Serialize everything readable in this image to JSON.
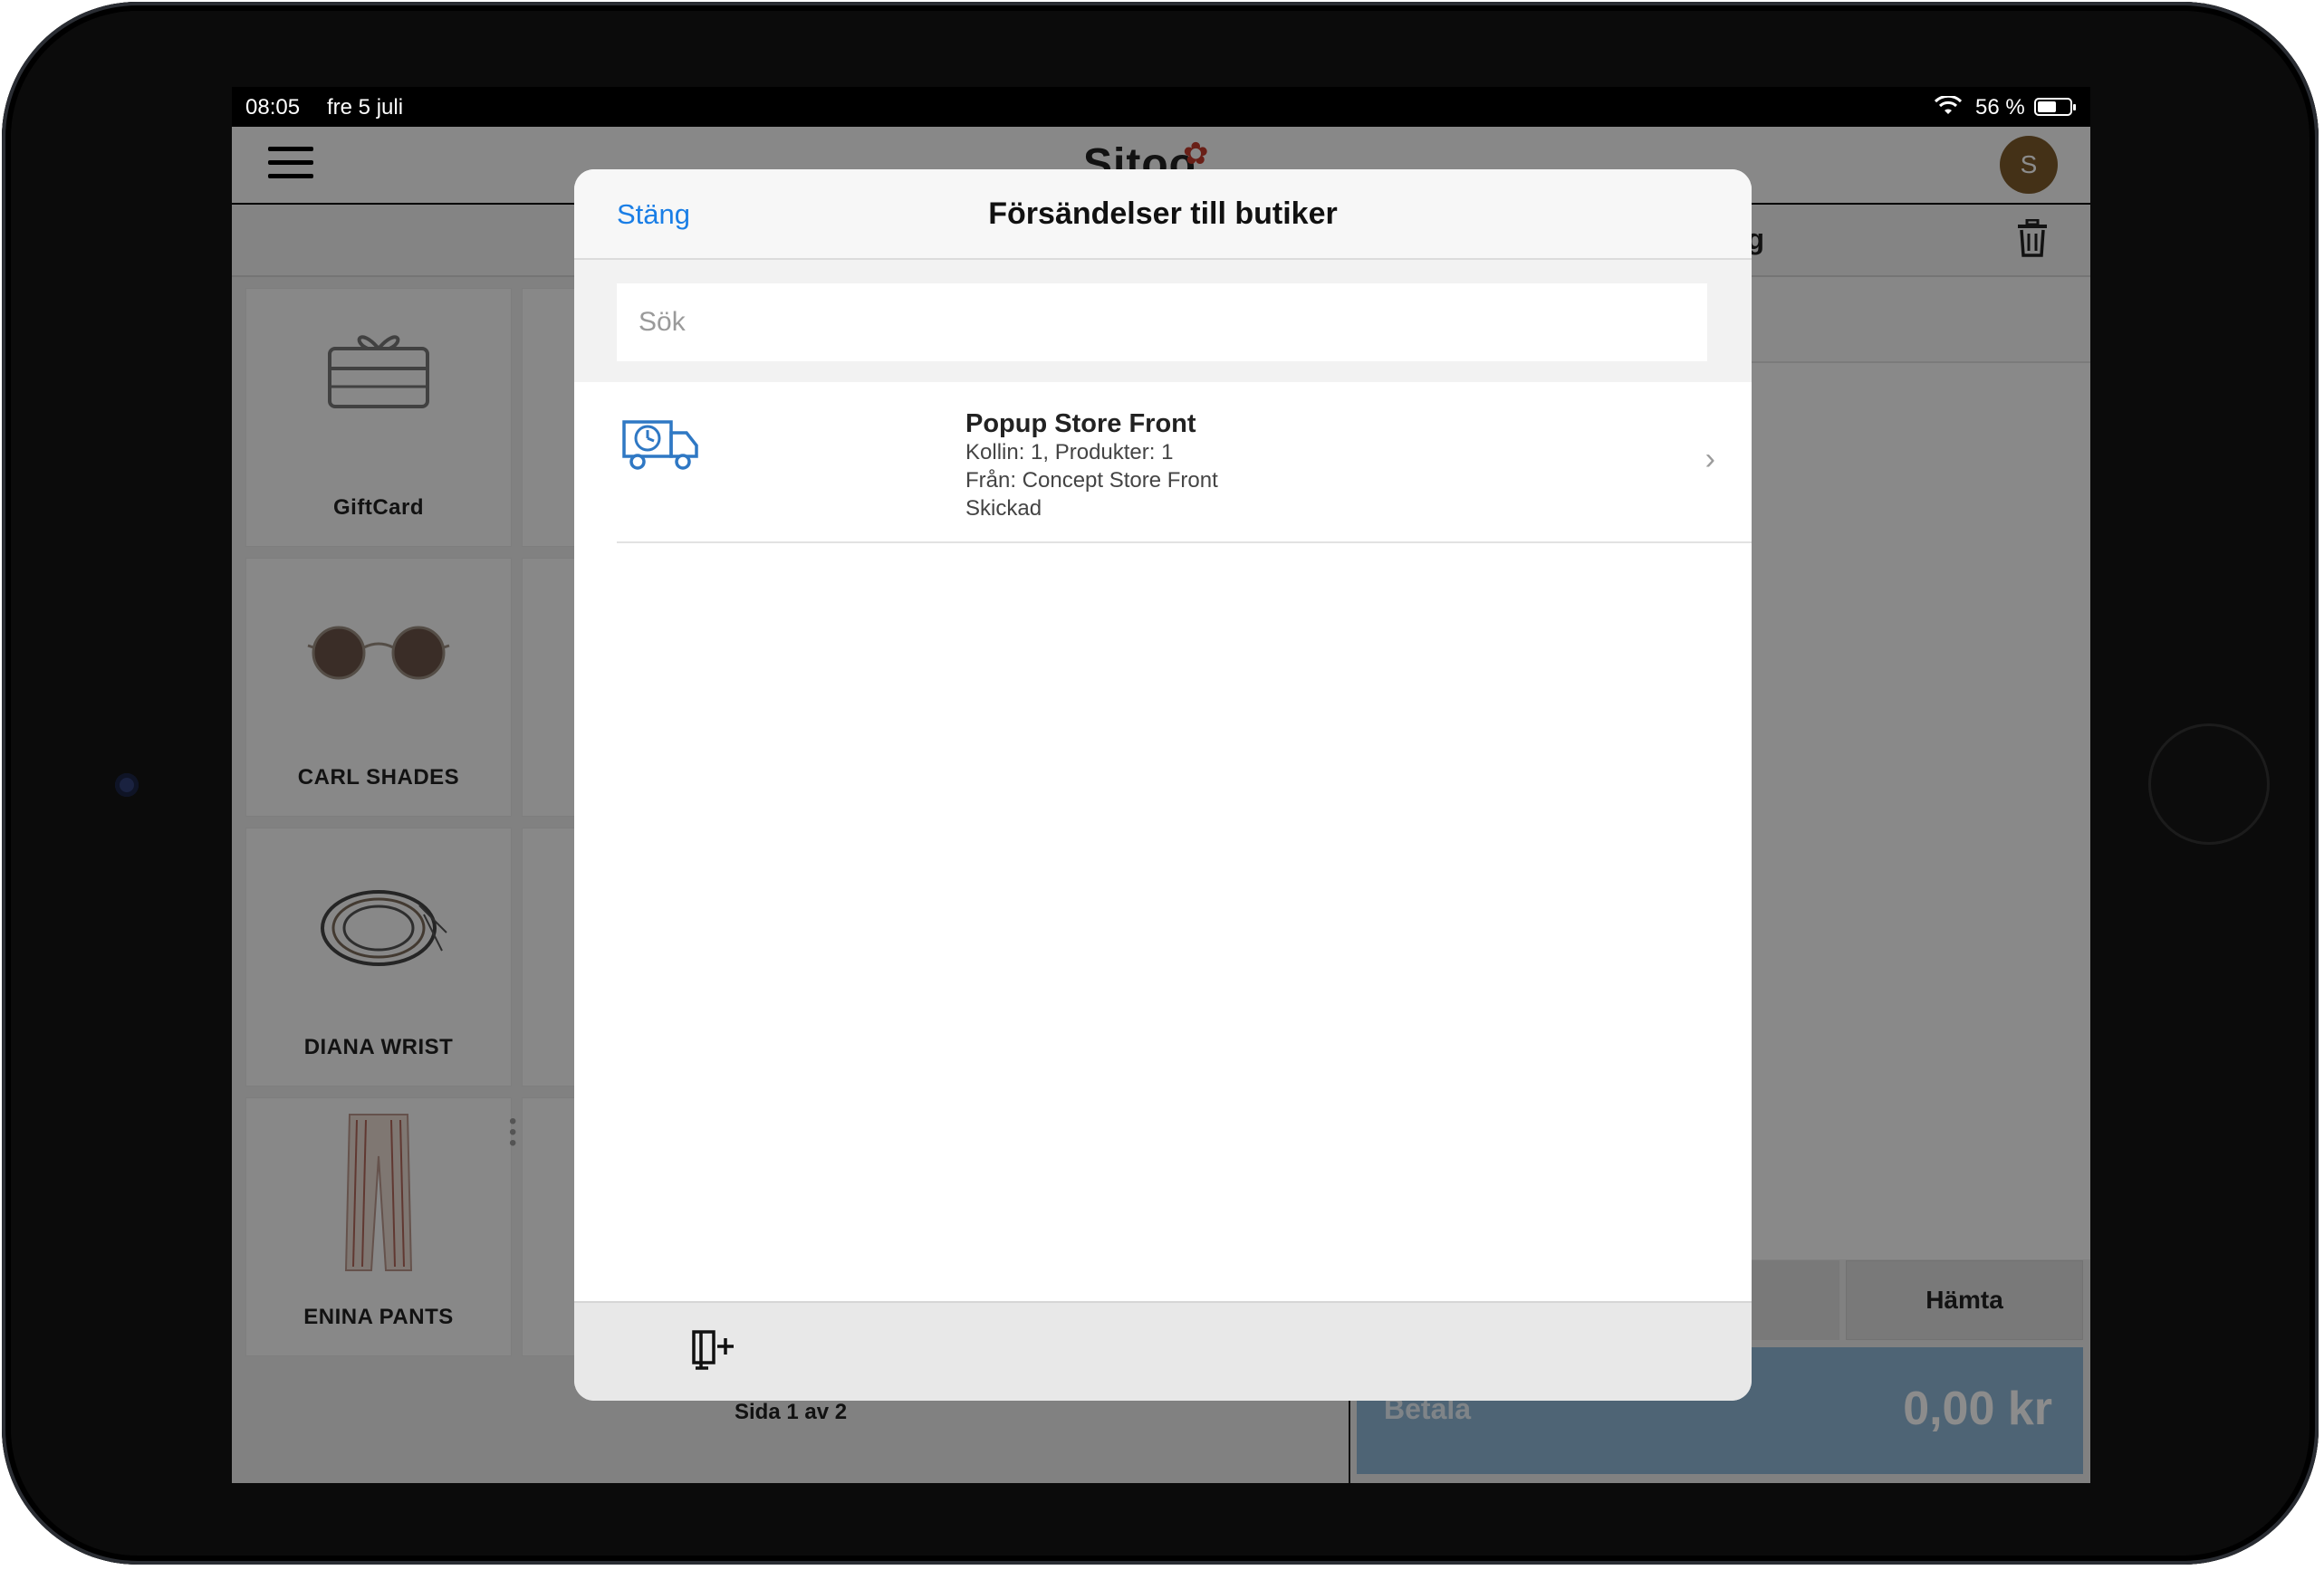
{
  "status_bar": {
    "time": "08:05",
    "date": "fre 5 juli",
    "battery": "56 %"
  },
  "app": {
    "logo": "Sitoo",
    "avatar_initial": "S",
    "cart_title_partial": "rg",
    "tiles": [
      {
        "label": "GiftCard"
      },
      {
        "label": "CARL SHADES"
      },
      {
        "label": "DIANA WRIST"
      },
      {
        "label": "ENINA PANTS"
      }
    ],
    "pager": "Sida 1 av 2",
    "hamta_label": "Hämta",
    "pay_label": "Betala",
    "pay_amount": "0,00 kr"
  },
  "modal": {
    "close_label": "Stäng",
    "title": "Försändelser till butiker",
    "search_placeholder": "Sök",
    "shipments": [
      {
        "name": "Popup Store Front",
        "detail": "Kollin: 1, Produkter: 1",
        "from": "Från: Concept Store Front",
        "status": "Skickad"
      }
    ]
  }
}
